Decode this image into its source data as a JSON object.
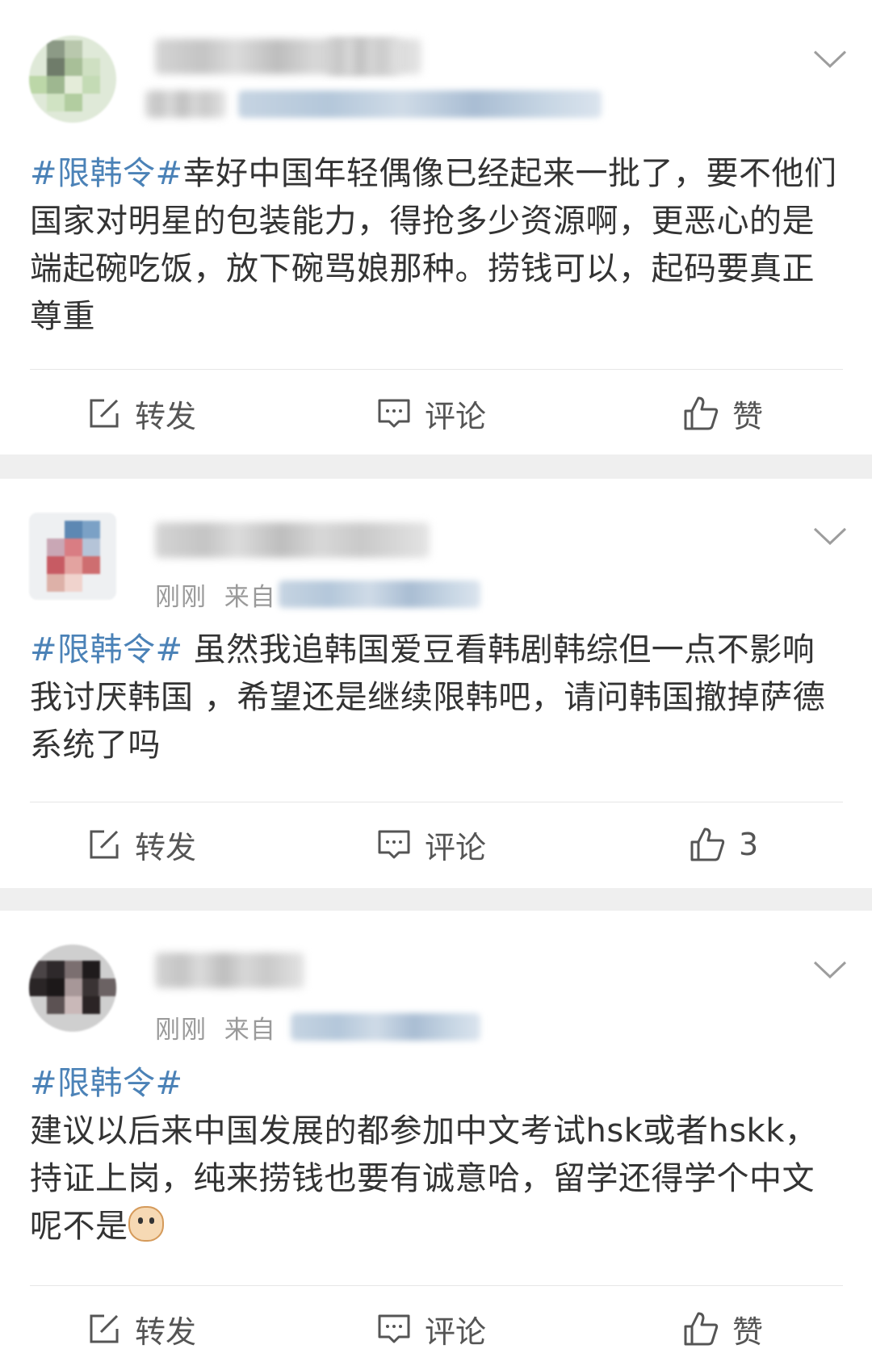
{
  "colors": {
    "hashtag": "#4b82b7",
    "body_text": "#333333",
    "meta_text": "#9a9a9a",
    "action_text": "#555555",
    "separator_bg": "#efefef"
  },
  "posts": [
    {
      "meta": {
        "time": "",
        "source_prefix": ""
      },
      "hashtag": "#限韩令#",
      "text": "幸好中国年轻偶像已经起来一批了，要不他们国家对明星的包装能力，得抢多少资源啊，更恶心的是端起碗吃饭，放下碗骂娘那种。捞钱可以，起码要真正尊重",
      "actions": {
        "repost": "转发",
        "comment": "评论",
        "like": "赞"
      },
      "icons": [
        "repost-icon",
        "comment-icon",
        "like-icon",
        "chevron-down-icon"
      ]
    },
    {
      "meta": {
        "time": "刚刚",
        "source_prefix": "来自"
      },
      "hashtag": "#限韩令#",
      "text": " 虽然我追韩国爱豆看韩剧韩综但一点不影响我讨厌韩国 ，希望还是继续限韩吧，请问韩国撤掉萨德系统了吗",
      "actions": {
        "repost": "转发",
        "comment": "评论",
        "like": "3"
      },
      "icons": [
        "repost-icon",
        "comment-icon",
        "like-icon",
        "chevron-down-icon"
      ]
    },
    {
      "meta": {
        "time": "刚刚",
        "source_prefix": "来自"
      },
      "hashtag": "#限韩令#",
      "text": "建议以后来中国发展的都参加中文考试hsk或者hskk，持证上岗，纯来捞钱也要有诚意哈，留学还得学个中文呢不是",
      "actions": {
        "repost": "转发",
        "comment": "评论",
        "like": "赞"
      },
      "icons": [
        "repost-icon",
        "comment-icon",
        "like-icon",
        "chevron-down-icon",
        "cat-emoji-icon"
      ]
    }
  ]
}
